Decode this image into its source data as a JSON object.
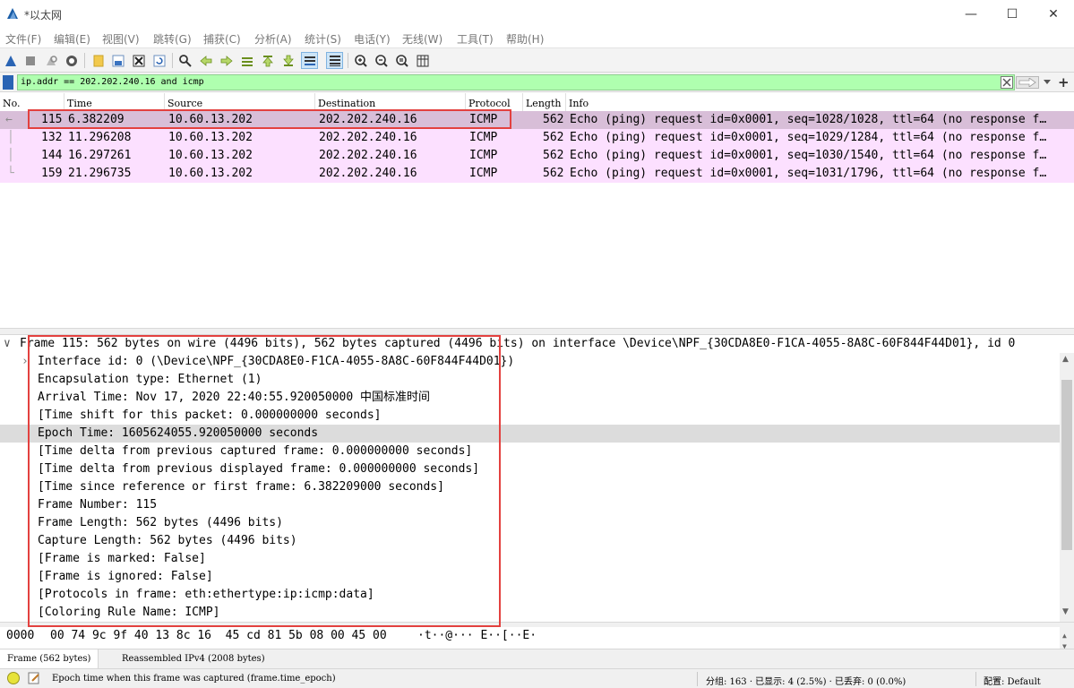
{
  "window": {
    "title": "*以太网",
    "minimize_glyph": "—",
    "maximize_glyph": "☐",
    "close_glyph": "✕"
  },
  "menu": [
    "文件(F)",
    "编辑(E)",
    "视图(V)",
    "跳转(G)",
    "捕获(C)",
    "分析(A)",
    "统计(S)",
    "电话(Y)",
    "无线(W)",
    "工具(T)",
    "帮助(H)"
  ],
  "toolbar_icons": [
    "start-capture-icon",
    "stop-capture-icon",
    "restart-capture-icon",
    "capture-options-icon",
    "open-file-icon",
    "save-file-icon",
    "close-file-icon",
    "reload-file-icon",
    "find-packet-icon",
    "go-back-icon",
    "go-forward-icon",
    "go-to-packet-icon",
    "go-first-icon",
    "go-last-icon",
    "auto-scroll-icon",
    "colorize-icon",
    "zoom-in-icon",
    "zoom-out-icon",
    "zoom-normal-icon",
    "resize-columns-icon"
  ],
  "filter": {
    "value": "ip.addr == 202.202.240.16 and icmp"
  },
  "packet_list": {
    "columns": [
      "No.",
      "Time",
      "Source",
      "Destination",
      "Protocol",
      "Length",
      "Info"
    ],
    "rows": [
      {
        "no": "115",
        "time": "6.382209",
        "source": "10.60.13.202",
        "destination": "202.202.240.16",
        "protocol": "ICMP",
        "length": "562",
        "info": "Echo (ping) request  id=0x0001, seq=1028/1028, ttl=64 (no response f…",
        "selected": true
      },
      {
        "no": "132",
        "time": "11.296208",
        "source": "10.60.13.202",
        "destination": "202.202.240.16",
        "protocol": "ICMP",
        "length": "562",
        "info": "Echo (ping) request  id=0x0001, seq=1029/1284, ttl=64 (no response f…",
        "selected": false
      },
      {
        "no": "144",
        "time": "16.297261",
        "source": "10.60.13.202",
        "destination": "202.202.240.16",
        "protocol": "ICMP",
        "length": "562",
        "info": "Echo (ping) request  id=0x0001, seq=1030/1540, ttl=64 (no response f…",
        "selected": false
      },
      {
        "no": "159",
        "time": "21.296735",
        "source": "10.60.13.202",
        "destination": "202.202.240.16",
        "protocol": "ICMP",
        "length": "562",
        "info": "Echo (ping) request  id=0x0001, seq=1031/1796, ttl=64 (no response f…",
        "selected": false
      }
    ]
  },
  "details": {
    "frame_header": "Frame 115: 562 bytes on wire (4496 bits), 562 bytes captured (4496 bits) on interface \\Device\\NPF_{30CDA8E0-F1CA-4055-8A8C-60F844F44D01}, id 0",
    "lines": [
      "Interface id: 0 (\\Device\\NPF_{30CDA8E0-F1CA-4055-8A8C-60F844F44D01})",
      "Encapsulation type: Ethernet (1)",
      "Arrival Time: Nov 17, 2020 22:40:55.920050000 中国标准时间",
      "[Time shift for this packet: 0.000000000 seconds]",
      "Epoch Time: 1605624055.920050000 seconds",
      "[Time delta from previous captured frame: 0.000000000 seconds]",
      "[Time delta from previous displayed frame: 0.000000000 seconds]",
      "[Time since reference or first frame: 6.382209000 seconds]",
      "Frame Number: 115",
      "Frame Length: 562 bytes (4496 bits)",
      "Capture Length: 562 bytes (4496 bits)",
      "[Frame is marked: False]",
      "[Frame is ignored: False]",
      "[Protocols in frame: eth:ethertype:ip:icmp:data]",
      "[Coloring Rule Name: ICMP]"
    ],
    "highlighted_index": 4
  },
  "bytes": {
    "offset": "0000",
    "hex": "00 74 9c 9f 40 13 8c 16  45 cd 81 5b 08 00 45 00",
    "ascii": "·t··@··· E··[··E·"
  },
  "bytes_tabs": [
    "Frame (562 bytes)",
    "Reassembled IPv4 (2008 bytes)"
  ],
  "status": {
    "field_desc": "Epoch time when this frame was captured (frame.time_epoch)",
    "stats": "分组: 163 · 已显示: 4 (2.5%) · 已丢弃: 0 (0.0%)",
    "profile": "配置: Default"
  },
  "colors": {
    "selected_row": "#d8bed8",
    "icmp_row": "#fce0ff",
    "filter_valid": "#afffaf",
    "annotation_box": "#e3413f",
    "highlight_line": "#dcdcdc"
  }
}
